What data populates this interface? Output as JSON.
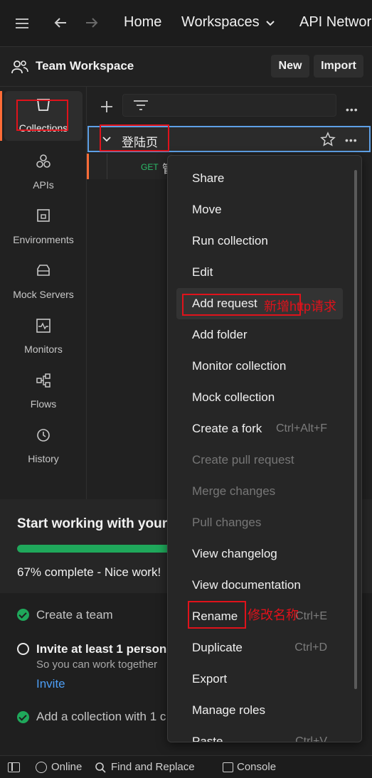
{
  "topbar": {
    "nav": [
      "Home",
      "Workspaces",
      "API Network"
    ],
    "workspaces_chevron": "chevron-down-icon"
  },
  "workspace": {
    "name": "Team Workspace",
    "new_label": "New",
    "import_label": "Import"
  },
  "sidebar": {
    "items": [
      {
        "label": "Collections",
        "icon": "collections-icon"
      },
      {
        "label": "APIs",
        "icon": "apis-icon"
      },
      {
        "label": "Environments",
        "icon": "environments-icon"
      },
      {
        "label": "Mock Servers",
        "icon": "mock-servers-icon"
      },
      {
        "label": "Monitors",
        "icon": "monitors-icon"
      },
      {
        "label": "Flows",
        "icon": "flows-icon"
      },
      {
        "label": "History",
        "icon": "history-icon"
      }
    ]
  },
  "collection": {
    "name": "登陆页",
    "request_method": "GET",
    "request_name_partial": "管"
  },
  "context_menu": {
    "items": [
      {
        "label": "Share",
        "shortcut": "",
        "disabled": false
      },
      {
        "label": "Move",
        "shortcut": "",
        "disabled": false
      },
      {
        "label": "Run collection",
        "shortcut": "",
        "disabled": false
      },
      {
        "label": "Edit",
        "shortcut": "",
        "disabled": false
      },
      {
        "label": "Add request",
        "shortcut": "",
        "disabled": false
      },
      {
        "label": "Add folder",
        "shortcut": "",
        "disabled": false
      },
      {
        "label": "Monitor collection",
        "shortcut": "",
        "disabled": false
      },
      {
        "label": "Mock collection",
        "shortcut": "",
        "disabled": false
      },
      {
        "label": "Create a fork",
        "shortcut": "Ctrl+Alt+F",
        "disabled": false
      },
      {
        "label": "Create pull request",
        "shortcut": "",
        "disabled": true
      },
      {
        "label": "Merge changes",
        "shortcut": "",
        "disabled": true
      },
      {
        "label": "Pull changes",
        "shortcut": "",
        "disabled": true
      },
      {
        "label": "View changelog",
        "shortcut": "",
        "disabled": false
      },
      {
        "label": "View documentation",
        "shortcut": "",
        "disabled": false
      },
      {
        "label": "Rename",
        "shortcut": "Ctrl+E",
        "disabled": false
      },
      {
        "label": "Duplicate",
        "shortcut": "Ctrl+D",
        "disabled": false
      },
      {
        "label": "Export",
        "shortcut": "",
        "disabled": false
      },
      {
        "label": "Manage roles",
        "shortcut": "",
        "disabled": false
      },
      {
        "label": "Paste",
        "shortcut": "Ctrl+V",
        "disabled": false
      }
    ]
  },
  "annotations": {
    "add_request_note": "新增http请求",
    "rename_note": "修改名称"
  },
  "onboarding": {
    "title": "Start working with your",
    "progress": 0.67,
    "progress_text": "67% complete - Nice work!",
    "tasks": [
      {
        "label": "Create a team",
        "done": true
      },
      {
        "label": "Invite at least 1 person",
        "done": false,
        "sub": "So you can work together",
        "link": "Invite"
      },
      {
        "label": "Add a collection with 1 c",
        "done": true
      }
    ]
  },
  "statusbar": {
    "online": "Online",
    "find_replace": "Find and Replace",
    "console": "Console"
  },
  "colors": {
    "accent_orange": "#ff6c37",
    "highlight_blue": "#5ea0e6",
    "annotation_red": "#e0121b",
    "progress_green": "#1fa85b",
    "link_blue": "#4d9ef5"
  }
}
